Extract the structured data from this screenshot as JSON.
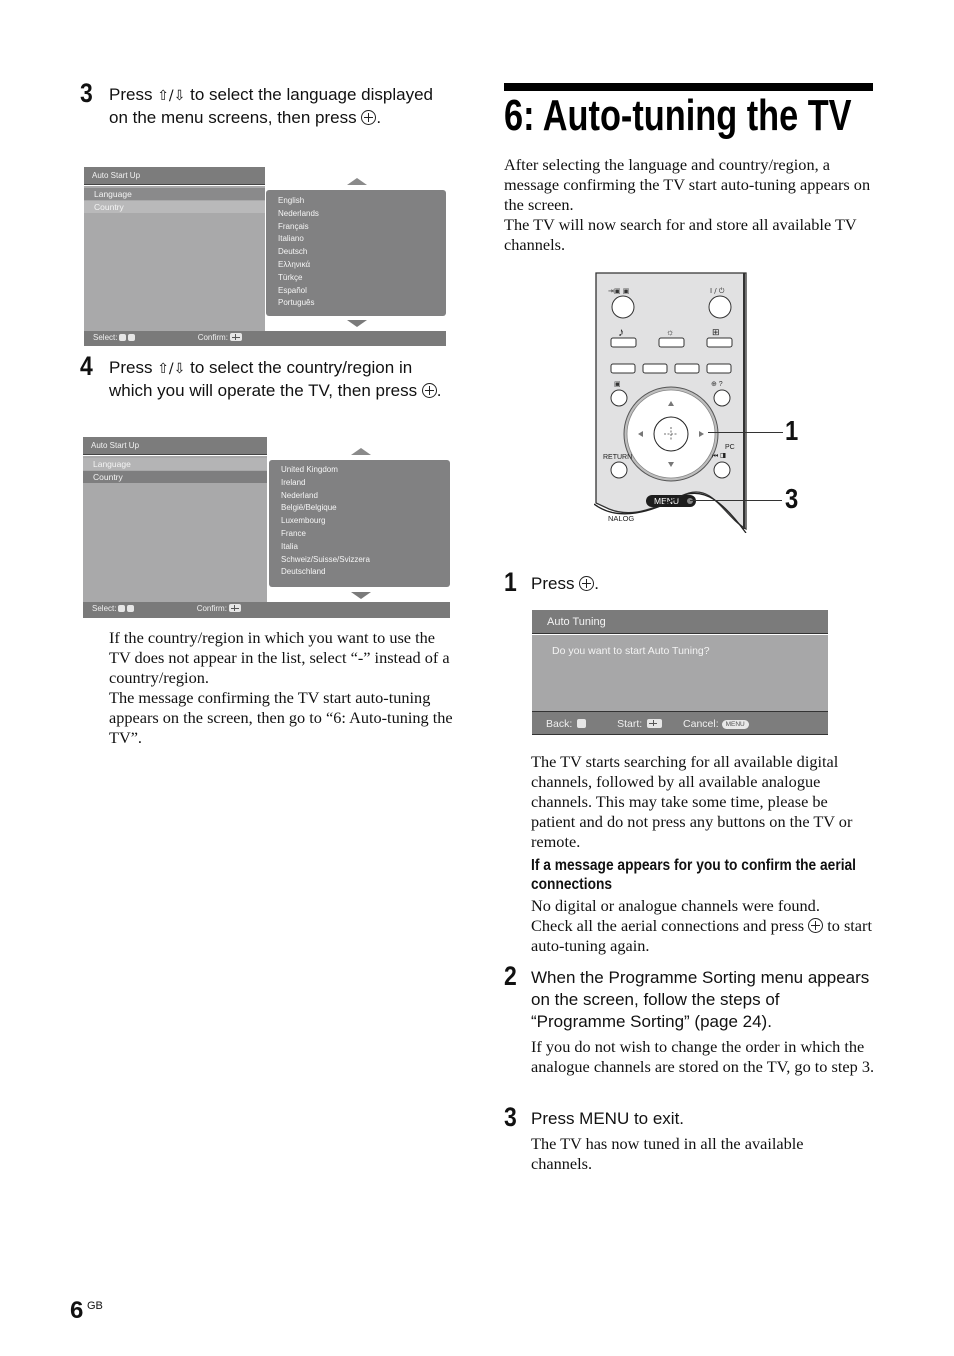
{
  "left_column": {
    "step3": {
      "number": "3",
      "text_before": "Press ",
      "arrows": "⇧/⇩",
      "text_after": " to select the language displayed on the menu screens, then press ",
      "end": "."
    },
    "osd1": {
      "title": "Auto Start Up",
      "rows": [
        "Language",
        "Country"
      ],
      "selected_row": "Language",
      "list": [
        "English",
        "Nederlands",
        "Français",
        "Italiano",
        "Deutsch",
        "Ελληνικά",
        "Türkçe",
        "Español",
        "Português"
      ],
      "footer_select": "Select:",
      "footer_confirm": "Confirm:"
    },
    "step4": {
      "number": "4",
      "text_before": "Press ",
      "arrows": "⇧/⇩",
      "text_after": " to select the country/region in which you will operate the TV, then press ",
      "end": "."
    },
    "osd2": {
      "title": "Auto Start Up",
      "rows": [
        "Language",
        "Country"
      ],
      "selected_row": "Country",
      "list": [
        "United Kingdom",
        "Ireland",
        "Nederland",
        "België/Belgique",
        "Luxembourg",
        "France",
        "Italia",
        "Schweiz/Suisse/Svizzera",
        "Deutschland"
      ],
      "footer_select": "Select:",
      "footer_confirm": "Confirm:"
    },
    "note": "If the country/region in which you want to use the TV does not appear in the list, select “-” instead of a country/region.",
    "note2": "The message confirming the TV start auto-tuning appears on the screen, then go to “6: Auto-tuning the TV”."
  },
  "right_column": {
    "heading": "6: Auto-tuning the TV",
    "intro1": "After selecting the language and country/region, a message confirming the TV start auto-tuning appears on the screen.",
    "intro2": "The TV will now search for and store all available TV channels.",
    "remote": {
      "labels": {
        "power": "I / ⏻",
        "return": "RETURN",
        "pc": "PC",
        "menu": "MENU",
        "analog": "ANALOG"
      },
      "callouts": [
        "1",
        "3"
      ]
    },
    "step1": {
      "number": "1",
      "text": "Press ",
      "end": "."
    },
    "auto_tuning_dialog": {
      "title": "Auto Tuning",
      "message": "Do you want to start Auto Tuning?",
      "back_label": "Back:",
      "start_label": "Start:",
      "cancel_label": "Cancel:",
      "menu_pill": "MENU"
    },
    "step1_desc": "The TV starts searching for all available digital channels, followed by all available analogue channels. This may take some time, please be patient and do not press any buttons on the TV or remote.",
    "subheading": "If a message appears for you to confirm the aerial connections",
    "sub_desc1": "No digital or analogue channels were found.",
    "sub_desc2_before": "Check all the aerial connections and press ",
    "sub_desc2_after": " to start auto-tuning again.",
    "step2": {
      "number": "2",
      "text": "When the Programme Sorting menu appears on the screen, follow the steps of “Programme Sorting” (page 24).",
      "desc": "If you do not wish to change the order in which the analogue channels are stored on the TV, go to step 3."
    },
    "step3": {
      "number": "3",
      "text": "Press MENU to exit.",
      "desc": "The TV has now tuned in all the available channels."
    }
  },
  "footer": {
    "page_number": "6",
    "page_suffix": "GB"
  }
}
